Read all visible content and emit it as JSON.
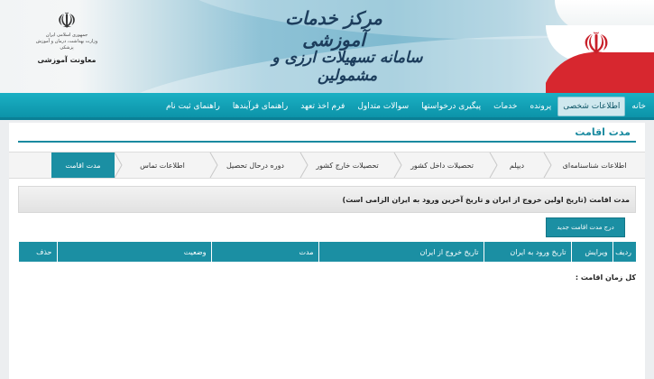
{
  "header": {
    "title": "مرکز خدمات آموزشی",
    "subtitle": "سامانه تسهیلات ارزی و مشمولین",
    "logo": {
      "line1": "جمهوری اسلامی ایران",
      "line2": "وزارت بهداشت، درمان و آموزش پزشکی",
      "line3": "معاونت آموزشی"
    }
  },
  "nav": {
    "items": [
      {
        "label": "خانه",
        "active": false
      },
      {
        "label": "اطلاعات شخصی",
        "active": true
      },
      {
        "label": "پرونده",
        "active": false
      },
      {
        "label": "خدمات",
        "active": false
      },
      {
        "label": "پیگیری درخواستها",
        "active": false
      },
      {
        "label": "سوالات متداول",
        "active": false
      },
      {
        "label": "فرم اخذ تعهد",
        "active": false
      },
      {
        "label": "راهنمای فرآیندها",
        "active": false
      },
      {
        "label": "راهنمای ثبت نام",
        "active": false
      }
    ]
  },
  "page": {
    "title": "مدت اقامت"
  },
  "tabs": [
    {
      "label": "اطلاعات شناسنامه‌ای",
      "active": false
    },
    {
      "label": "دیپلم",
      "active": false
    },
    {
      "label": "تحصیلات داخل کشور",
      "active": false
    },
    {
      "label": "تحصیلات خارج کشور",
      "active": false
    },
    {
      "label": "دوره درحال تحصیل",
      "active": false
    },
    {
      "label": "اطلاعات تماس",
      "active": false
    },
    {
      "label": "مدت اقامت",
      "active": true
    }
  ],
  "panel": {
    "heading": "مدت اقامت (تاریخ اولین خروج از ایران و تاریخ آخرین ورود به ایران الزامی است)",
    "new_button": "درج مدت اقامت جدید",
    "columns": [
      "ردیف",
      "ویرایش",
      "تاریخ ورود به ایران",
      "تاریخ خروج از ایران",
      "مدت",
      "وضعیت",
      "حذف"
    ],
    "total_label": "کل زمان اقامت :"
  },
  "colors": {
    "accent": "#1b8fa3",
    "nav": "#0c93a9"
  }
}
